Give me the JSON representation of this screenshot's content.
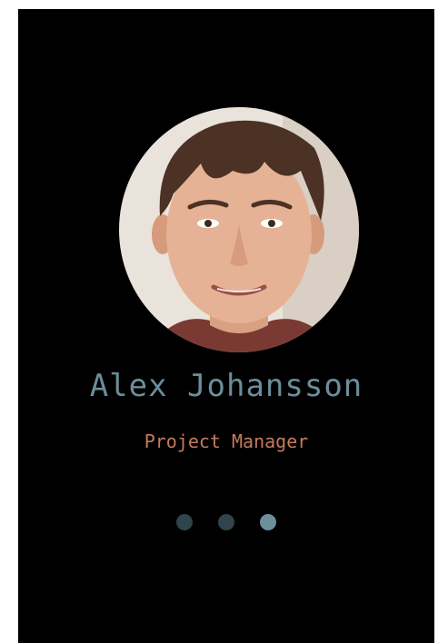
{
  "profile": {
    "name": "Alex Johansson",
    "title": "Project Manager",
    "avatar_icon": "person-portrait"
  },
  "carousel": {
    "pages": 3,
    "active_index": 2
  },
  "colors": {
    "background": "#000000",
    "name": "#6b8e9b",
    "title": "#c47b5c",
    "dot_inactive": "#2f444c",
    "dot_active": "#6c8f9b"
  }
}
